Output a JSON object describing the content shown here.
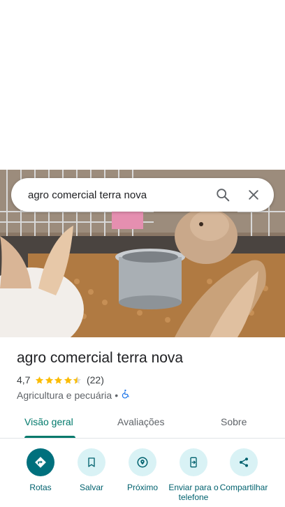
{
  "search": {
    "query": "agro comercial terra nova"
  },
  "place": {
    "name": "agro comercial terra nova",
    "rating": "4,7",
    "rating_value": 4.7,
    "reviews_count": "(22)",
    "category": "Agricultura e pecuária",
    "separator": "•"
  },
  "tabs": [
    {
      "label": "Visão geral",
      "active": true
    },
    {
      "label": "Avaliações",
      "active": false
    },
    {
      "label": "Sobre",
      "active": false
    }
  ],
  "actions": [
    {
      "label": "Rotas",
      "icon": "directions-icon"
    },
    {
      "label": "Salvar",
      "icon": "bookmark-icon"
    },
    {
      "label": "Próximo",
      "icon": "nearby-icon"
    },
    {
      "label": "Enviar para o telefone",
      "icon": "send-to-phone-icon"
    },
    {
      "label": "Compartilhar",
      "icon": "share-icon"
    }
  ],
  "colors": {
    "accent": "#00796b",
    "action_bg": "#d9f2f5",
    "action_primary": "#00707d",
    "star": "#fbbc04"
  }
}
